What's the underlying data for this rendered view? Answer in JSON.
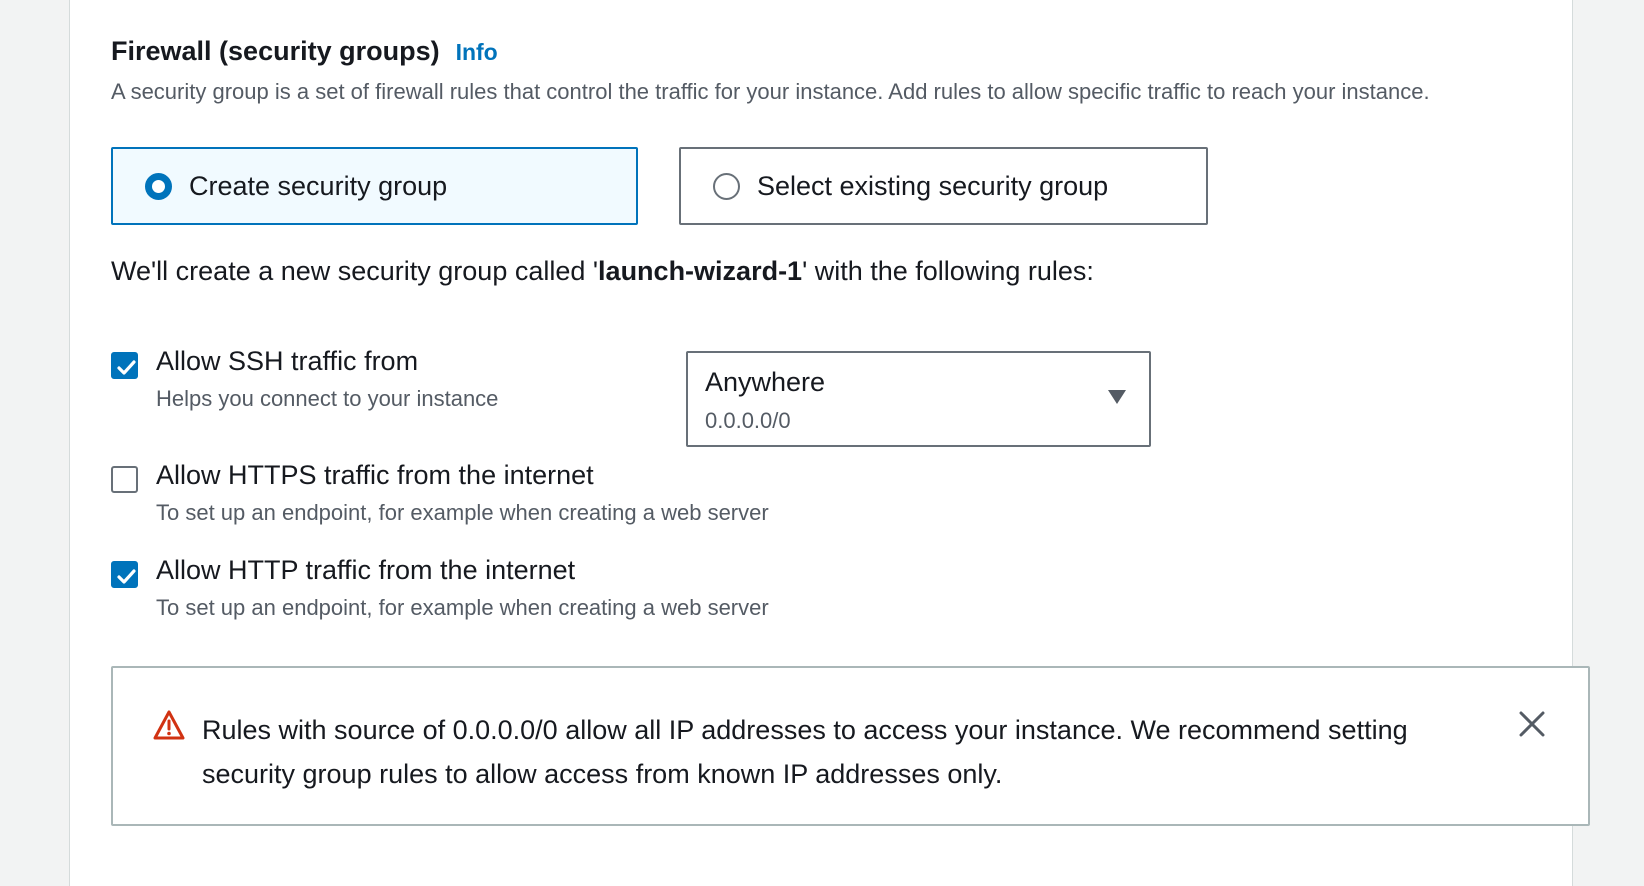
{
  "firewall": {
    "title": "Firewall (security groups)",
    "info_label": "Info",
    "description": "A security group is a set of firewall rules that control the traffic for your instance. Add rules to allow specific traffic to reach your instance."
  },
  "options": [
    {
      "label": "Create security group",
      "selected": true
    },
    {
      "label": "Select existing security group",
      "selected": false
    }
  ],
  "summary": {
    "prefix": "We'll create a new security group called '",
    "group_name": "launch-wizard-1",
    "suffix": "' with the following rules:"
  },
  "rules": [
    {
      "label": "Allow SSH traffic from",
      "description": "Helps you connect to your instance",
      "checked": true
    },
    {
      "label": "Allow HTTPS traffic from the internet",
      "description": "To set up an endpoint, for example when creating a web server",
      "checked": false
    },
    {
      "label": "Allow HTTP traffic from the internet",
      "description": "To set up an endpoint, for example when creating a web server",
      "checked": true
    }
  ],
  "ssh_source": {
    "value": "Anywhere",
    "sub": "0.0.0.0/0"
  },
  "alert": {
    "text": "Rules with source of 0.0.0.0/0 allow all IP addresses to access your instance. We recommend setting security group rules to allow access from known IP addresses only."
  },
  "icons": {
    "warning": "warning-triangle-icon",
    "close": "close-icon",
    "caret": "caret-down-icon",
    "check": "checkmark-icon"
  },
  "colors": {
    "accent": "#0073bb",
    "warning": "#d13212",
    "text": "#16191f",
    "secondary_text": "#545b64",
    "selected_tile_bg": "#f1faff"
  }
}
